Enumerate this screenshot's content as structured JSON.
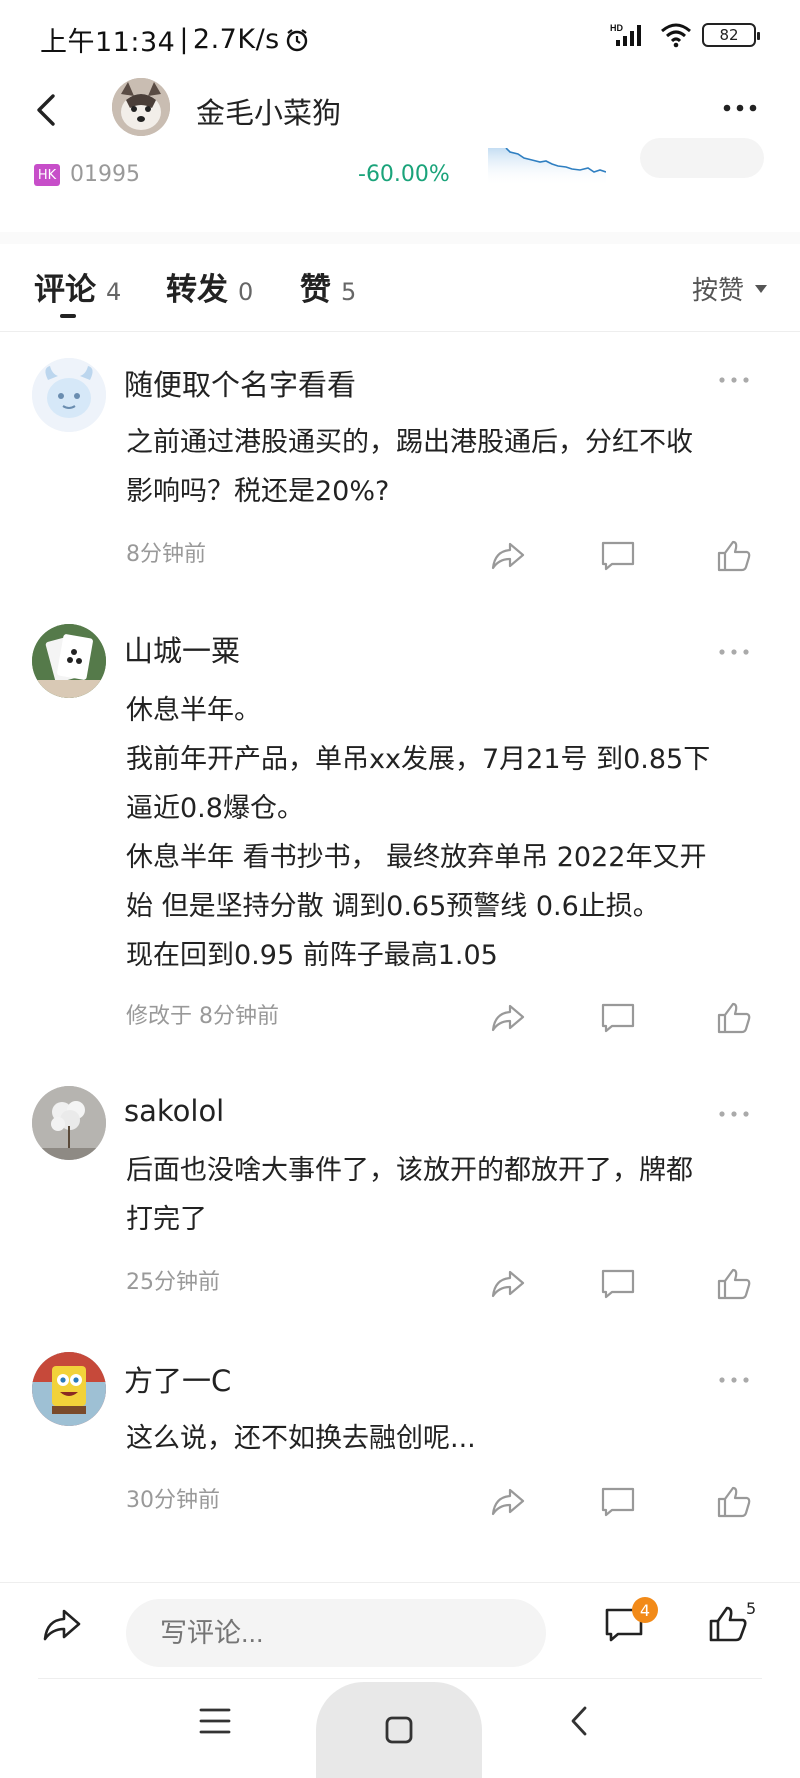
{
  "status_bar": {
    "time": "上午11:34",
    "speed": "2.7K/s",
    "battery": "82",
    "hd_label": "HD"
  },
  "header": {
    "title": "金毛小菜狗"
  },
  "stock": {
    "market": "HK",
    "code": "01995",
    "change": "-60.00%"
  },
  "tabs": [
    {
      "label": "评论",
      "count": "4"
    },
    {
      "label": "转发",
      "count": "0"
    },
    {
      "label": "赞",
      "count": "5"
    }
  ],
  "sort": {
    "label": "按赞"
  },
  "comments": [
    {
      "name": "随便取个名字看看",
      "lines": [
        "之前通过港股通买的，踢出港股通后，分红不收",
        "影响吗？税还是20%?"
      ],
      "time": "8分钟前"
    },
    {
      "name": "山城一粟",
      "lines": [
        "休息半年。",
        "我前年开产品，单吊xx发展，7月21号 到0.85下",
        "逼近0.8爆仓。",
        "休息半年 看书抄书， 最终放弃单吊 2022年又开",
        "始 但是坚持分散 调到0.65预警线 0.6止损。",
        "现在回到0.95 前阵子最高1.05"
      ],
      "time": "修改于 8分钟前"
    },
    {
      "name": "sakolol",
      "lines": [
        "后面也没啥大事件了，该放开的都放开了，牌都",
        "打完了"
      ],
      "time": "25分钟前"
    },
    {
      "name": "方了一C",
      "lines": [
        "这么说，还不如换去融创呢..."
      ],
      "time": "30分钟前"
    }
  ],
  "bottom_bar": {
    "input_placeholder": "写评论...",
    "comment_badge": "4",
    "like_count": "5"
  },
  "colors": {
    "change_green": "#1aa37a",
    "badge_orange": "#f28a18",
    "hk_purple": "#c74ec9"
  }
}
